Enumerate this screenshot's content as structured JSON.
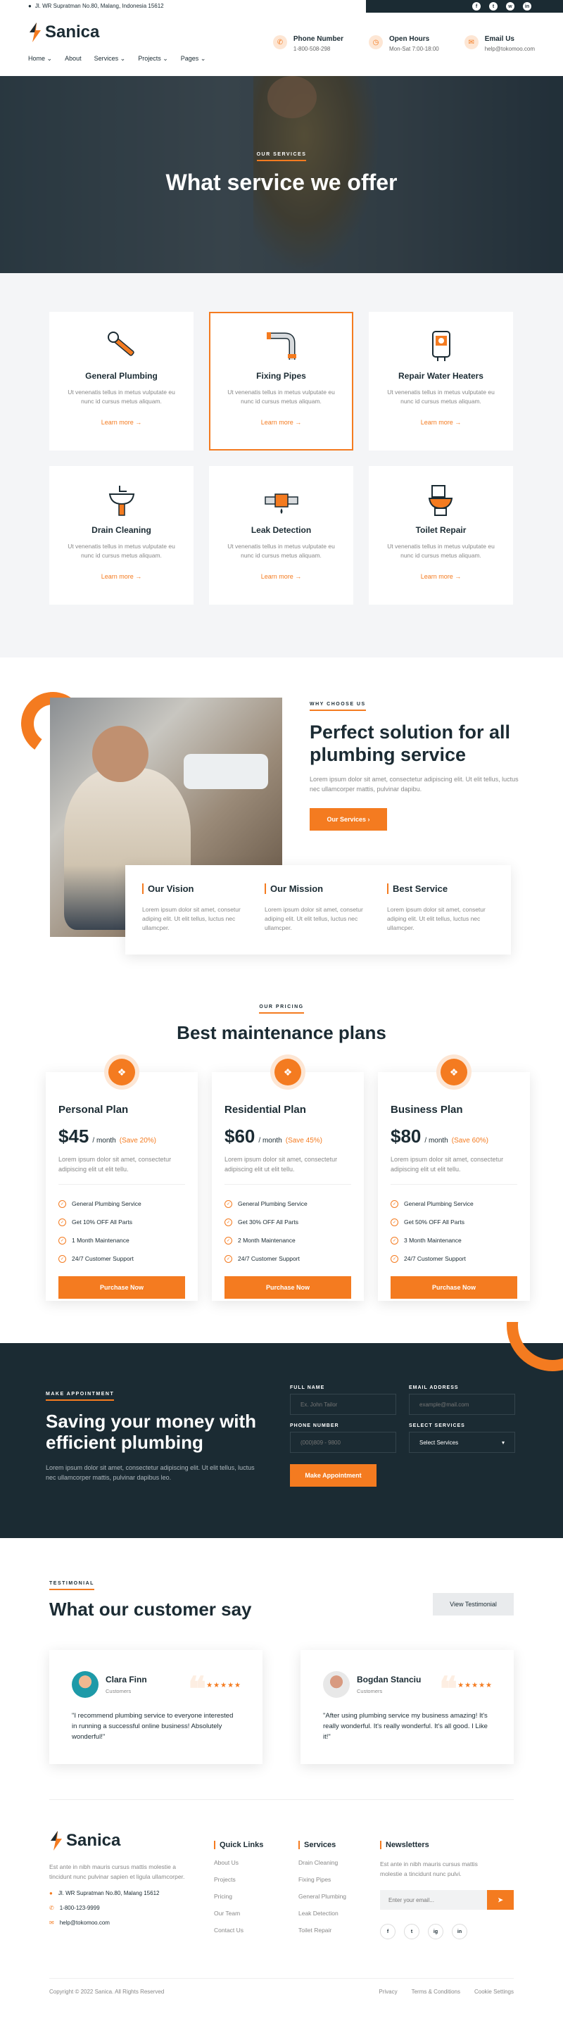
{
  "topbar": {
    "address": "Jl. WR Supratman No.80, Malang, Indonesia 15612",
    "socials": [
      {
        "name": "facebook-icon",
        "glyph": "f"
      },
      {
        "name": "twitter-icon",
        "glyph": "t"
      },
      {
        "name": "whatsapp-icon",
        "glyph": "w"
      },
      {
        "name": "linkedin-icon",
        "glyph": "in"
      }
    ]
  },
  "header": {
    "logo": "Sanica",
    "nav": [
      "Home",
      "About",
      "Services",
      "Projects",
      "Pages"
    ],
    "info": [
      {
        "title": "Phone Number",
        "sub": "1-800-508-298",
        "icon": "phone-icon"
      },
      {
        "title": "Open Hours",
        "sub": "Mon-Sat 7:00-18:00",
        "icon": "clock-icon"
      },
      {
        "title": "Email Us",
        "sub": "help@tokomoo.com",
        "icon": "mail-icon"
      }
    ]
  },
  "hero": {
    "eyebrow": "OUR SERVICES",
    "title": "What service we offer"
  },
  "services": [
    {
      "title": "General Plumbing",
      "desc": "Ut venenatis tellus in metus vulputate eu nunc id cursus metus aliquam.",
      "link": "Learn more",
      "icon": "wrench-icon"
    },
    {
      "title": "Fixing Pipes",
      "desc": "Ut venenatis tellus in metus vulputate eu nunc id cursus metus aliquam.",
      "link": "Learn more",
      "icon": "pipe-icon"
    },
    {
      "title": "Repair Water Heaters",
      "desc": "Ut venenatis tellus in metus vulputate eu nunc id cursus metus aliquam.",
      "link": "Learn more",
      "icon": "water-heater-icon"
    },
    {
      "title": "Drain Cleaning",
      "desc": "Ut venenatis tellus in metus vulputate eu nunc id cursus metus aliquam.",
      "link": "Learn more",
      "icon": "sink-icon"
    },
    {
      "title": "Leak Detection",
      "desc": "Ut venenatis tellus in metus vulputate eu nunc id cursus metus aliquam.",
      "link": "Learn more",
      "icon": "leak-icon"
    },
    {
      "title": "Toilet Repair",
      "desc": "Ut venenatis tellus in metus vulputate eu nunc id cursus metus aliquam.",
      "link": "Learn more",
      "icon": "toilet-icon"
    }
  ],
  "why": {
    "eyebrow": "WHY CHOOSE US",
    "title": "Perfect solution for all plumbing service",
    "desc": "Lorem ipsum dolor sit amet, consectetur adipiscing elit. Ut elit tellus, luctus nec ullamcorper mattis, pulvinar dapibu.",
    "button": "Our Services",
    "cards": [
      {
        "title": "Our Vision",
        "desc": "Lorem ipsum dolor sit amet, consetur adiping elit. Ut elit tellus, luctus nec ullamcper."
      },
      {
        "title": "Our Mission",
        "desc": "Lorem ipsum dolor sit amet, consetur adiping elit. Ut elit tellus, luctus nec ullamcper."
      },
      {
        "title": "Best Service",
        "desc": "Lorem ipsum dolor sit amet, consetur adiping elit. Ut elit tellus, luctus nec ullamcper."
      }
    ]
  },
  "pricing": {
    "eyebrow": "OUR PRICING",
    "title": "Best maintenance plans",
    "plans": [
      {
        "name": "Personal Plan",
        "price": "$45",
        "per": "/ month",
        "save": "(Save 20%)",
        "desc": "Lorem ipsum dolor sit amet, consectetur adipiscing elit ut elit tellu.",
        "features": [
          "General Plumbing Service",
          "Get 10% OFF All Parts",
          "1 Month Maintenance",
          "24/7 Customer Support"
        ],
        "button": "Purchase Now"
      },
      {
        "name": "Residential Plan",
        "price": "$60",
        "per": "/ month",
        "save": "(Save 45%)",
        "desc": "Lorem ipsum dolor sit amet, consectetur adipiscing elit ut elit tellu.",
        "features": [
          "General Plumbing Service",
          "Get 30% OFF All Parts",
          "2 Month Maintenance",
          "24/7 Customer Support"
        ],
        "button": "Purchase Now"
      },
      {
        "name": "Business Plan",
        "price": "$80",
        "per": "/ month",
        "save": "(Save 60%)",
        "desc": "Lorem ipsum dolor sit amet, consectetur adipiscing elit ut elit tellu.",
        "features": [
          "General Plumbing Service",
          "Get 50% OFF All Parts",
          "3 Month Maintenance",
          "24/7 Customer Support"
        ],
        "button": "Purchase Now"
      }
    ]
  },
  "appointment": {
    "eyebrow": "MAKE APPOINTMENT",
    "title": "Saving your money with efficient plumbing",
    "desc": "Lorem ipsum dolor sit amet, consectetur adipiscing elit. Ut elit tellus, luctus nec ullamcorper mattis, pulvinar dapibus leo.",
    "fields": {
      "name_label": "FULL NAME",
      "name_ph": "Ex. John Tailor",
      "email_label": "EMAIL ADDRESS",
      "email_ph": "example@mail.com",
      "phone_label": "PHONE NUMBER",
      "phone_ph": "(000)809 - 9800",
      "service_label": "SELECT SERVICES",
      "service_value": "Select Services"
    },
    "button": "Make Appointment"
  },
  "testimonials": {
    "eyebrow": "TESTIMONIAL",
    "title": "What our customer say",
    "button": "View Testimonial",
    "items": [
      {
        "name": "Clara Finn",
        "role": "Customers",
        "stars": "★★★★★",
        "quote": "\"I recommend plumbing service to everyone interested in running a successful online business! Absolutely wonderful!\""
      },
      {
        "name": "Bogdan Stanciu",
        "role": "Customers",
        "stars": "★★★★★",
        "quote": "\"After using plumbing service my business amazing! It's really wonderful. It's really wonderful. It's all good. I Like it!\""
      }
    ]
  },
  "footer": {
    "logo": "Sanica",
    "desc": "Est ante in nibh mauris cursus mattis molestie a tincidunt nunc pulvinar sapien et ligula ullamcorper.",
    "address": "Jl. WR Supratman No.80, Malang 15612",
    "phone": "1-800-123-9999",
    "email": "help@tokomoo.com",
    "quick_title": "Quick Links",
    "quick_links": [
      "About Us",
      "Projects",
      "Pricing",
      "Our Team",
      "Contact Us"
    ],
    "services_title": "Services",
    "services_links": [
      "Drain Cleaning",
      "Fixing Pipes",
      "General Plumbing",
      "Leak Detection",
      "Toilet Repair"
    ],
    "news_title": "Newsletters",
    "news_desc": "Est ante in nibh mauris cursus mattis molestie a tincidunt nunc pulvi.",
    "news_ph": "Enter your email...",
    "socials": [
      "f",
      "t",
      "ig",
      "in"
    ],
    "copyright": "Copyright © 2022 Sanica. All Rights Reserved",
    "bottom_links": [
      "Privacy",
      "Terms & Conditions",
      "Cookie Settings"
    ]
  },
  "colors": {
    "accent": "#f47b20",
    "dark": "#1b2b33"
  }
}
